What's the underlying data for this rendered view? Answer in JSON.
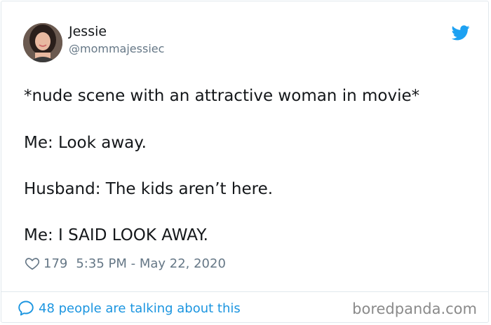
{
  "author": {
    "name": "Jessie",
    "handle": "@mommajessiec",
    "avatar_icon": "profile-photo"
  },
  "tweet": {
    "lines": [
      "*nude scene with an attractive woman in movie*",
      "Me: Look away.",
      "Husband: The kids aren’t here.",
      "Me: I SAID LOOK AWAY."
    ]
  },
  "meta": {
    "likes": "179",
    "timestamp": "5:35 PM - May 22, 2020",
    "like_icon": "heart-icon"
  },
  "footer": {
    "conversation_text": "48 people are talking about this",
    "conversation_icon": "speech-bubble-icon",
    "watermark": "boredpanda.com"
  },
  "colors": {
    "accent": "#1da1f2",
    "link": "#1b95e0",
    "text": "#14171a",
    "muted": "#657786",
    "border": "#e1e8ed"
  }
}
